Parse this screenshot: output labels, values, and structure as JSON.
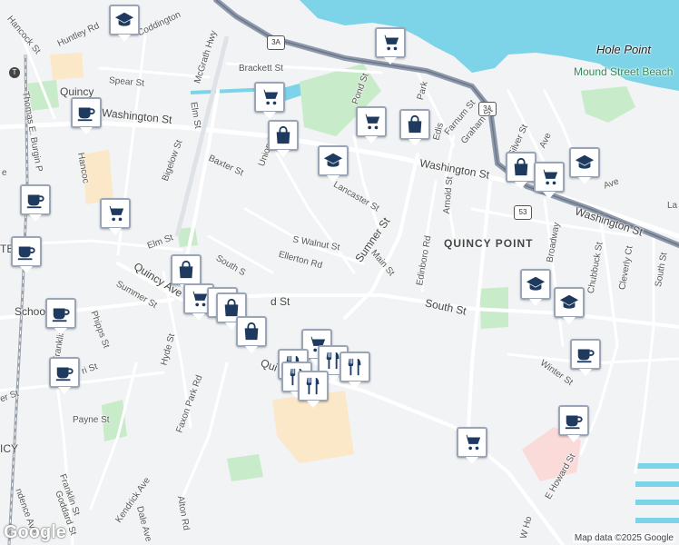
{
  "map": {
    "attribution": "Map data ©2025 Google",
    "logo": "Google",
    "colors": {
      "land": "#f1f3f4",
      "water": "#7dd3e8",
      "park": "#c8ebc9",
      "road": "#ffffff",
      "highway": "#8e99ab",
      "rail": "#9aa1ab",
      "campus": "#fbe8c8",
      "hospital": "#fbdada",
      "pin_icon": "#1e3a5f"
    },
    "shields": [
      "3A",
      "3A",
      "53"
    ],
    "labels": {
      "hole_point": "Hole Point",
      "mound_street_beach": "Mound Street Beach",
      "quincy_point": "QUINCY POINT",
      "quincy": "Quincy",
      "quincy_edge": "ICY",
      "hancock_st": "Hancock St",
      "huntley_rd": "Huntley Rd",
      "coddington": "Coddington",
      "spear_st": "Spear St",
      "brackett_st": "Brackett St",
      "mcgrath_hwy": "McGrath Hwy",
      "washington_st_w": "Washington St",
      "elm_st": "Elm St",
      "elm_st_2": "Elm St",
      "bigelow_st": "Bigelow St",
      "baxter_st": "Baxter St",
      "union_st": "Union St",
      "pond_st": "Pond St",
      "lancaster_st": "Lancaster St",
      "washington_st_c": "Washington St",
      "washington_st_e": "Washington St",
      "farnum_st": "Farnum St",
      "graham_st": "Graham St",
      "park": "Park",
      "edison": "Edis",
      "arnold_st": "Arnold St",
      "silver_st": "Silver St",
      "ave": "Ave",
      "ave_2": "Ave",
      "broadway": "Broadway",
      "chubbuck_st": "Chubbuck St",
      "cleverly_ct": "Cleverly Ct",
      "south_st_e": "South St",
      "la": "La",
      "thomas_burgin": "Thomas E. Burgin P",
      "hancock_2": "Hancoc",
      "s_walnut_st": "S Walnut St",
      "ellerton_rd": "Ellerton Rd",
      "sumner_st": "Sumner St",
      "main_st": "Main St",
      "edinboro_rd": "Edinboro Rd",
      "south_st": "South St",
      "south_s": "South S",
      "d_st": "d St",
      "quincy_ave": "Quincy Ave",
      "summer_st": "Summer St",
      "phipps_st": "Phipps St",
      "school": "School",
      "hyde_st": "Hyde St",
      "franklin_st_n": "Franklin",
      "ri_st": "ri St",
      "er_st": "er St",
      "payne_st": "Payne St",
      "faxon_park_rd": "Faxon Park Rd",
      "qui": "Qui",
      "winter_st": "Winter St",
      "e_howard_st": "E Howard St",
      "w_ho": "W Ho",
      "franklin_st": "Franklin St",
      "goddard_st": "Goddard St",
      "independence_ave": "ndence Ave",
      "kendrick_ave": "Kendrick Ave",
      "dale_ave": "Dale Ave",
      "alton_rd": "Alton Rd",
      "e_ave": "e",
      "te": "TE"
    },
    "pins": [
      {
        "type": "school-icon"
      },
      {
        "type": "shopping-cart-icon"
      },
      {
        "type": "cafe-icon"
      },
      {
        "type": "shopping-cart-icon"
      },
      {
        "type": "shopping-bag-icon"
      },
      {
        "type": "shopping-cart-icon"
      },
      {
        "type": "shopping-bag-icon"
      },
      {
        "type": "school-icon"
      },
      {
        "type": "shopping-bag-icon"
      },
      {
        "type": "shopping-cart-icon"
      },
      {
        "type": "school-icon"
      },
      {
        "type": "cafe-icon"
      },
      {
        "type": "shopping-cart-icon"
      },
      {
        "type": "cafe-icon"
      },
      {
        "type": "shopping-bag-icon"
      },
      {
        "type": "shopping-cart-icon"
      },
      {
        "type": "shopping-cart-icon"
      },
      {
        "type": "shopping-bag-icon"
      },
      {
        "type": "shopping-bag-icon"
      },
      {
        "type": "cafe-icon"
      },
      {
        "type": "cafe-icon"
      },
      {
        "type": "shopping-cart-icon"
      },
      {
        "type": "restaurant-icon"
      },
      {
        "type": "restaurant-icon"
      },
      {
        "type": "restaurant-icon"
      },
      {
        "type": "restaurant-icon"
      },
      {
        "type": "restaurant-icon"
      },
      {
        "type": "school-icon"
      },
      {
        "type": "school-icon"
      },
      {
        "type": "cafe-icon"
      },
      {
        "type": "cafe-icon"
      },
      {
        "type": "shopping-cart-icon"
      }
    ]
  }
}
